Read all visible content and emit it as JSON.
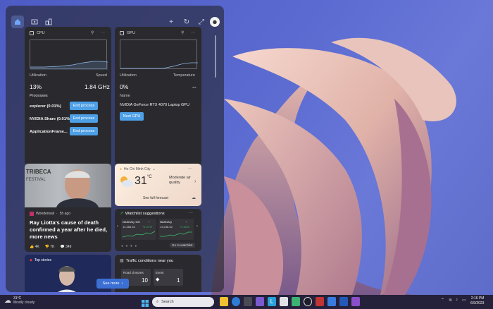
{
  "panel": {
    "icons": [
      "home-icon",
      "video-icon",
      "widgets-icon",
      "plus-icon",
      "refresh-icon",
      "expand-icon"
    ]
  },
  "cpu": {
    "title": "CPU",
    "util_label": "Utilization",
    "speed_label": "Speed",
    "util": "13%",
    "speed": "1.84 GHz",
    "processes_label": "Processes",
    "procs": [
      {
        "name": "explorer (0.01%)",
        "action": "End process"
      },
      {
        "name": "NVIDIA Share (0.01%)",
        "action": "End process"
      },
      {
        "name": "ApplicationFrame...",
        "action": "End process"
      }
    ]
  },
  "gpu": {
    "title": "GPU",
    "util_label": "Utilization",
    "temp_label": "Temperature",
    "util": "0%",
    "temp": "--",
    "name_label": "Name",
    "name": "NVIDIA GeForce RTX 4070 Laptop GPU",
    "next": "Next GPU"
  },
  "news1": {
    "source": "Wonderwall",
    "time": "5h ago",
    "sign": "TRIBECA",
    "sign2": "FESTIVAL",
    "headline": "Ray Liotta's cause of death confirmed a year after he died, more news",
    "likes": "4K",
    "dislikes": "7K",
    "comments": "349"
  },
  "weather": {
    "city": "Ho Chi Minh City",
    "temp": "31",
    "unit": "°C",
    "aqi": "Moderate air quality",
    "forecast": "See full forecast"
  },
  "watch": {
    "title": "Watchlist suggestions",
    "items": [
      {
        "name": "NASDAQ 100",
        "value": "14,484.54",
        "change": "+1.27%"
      },
      {
        "name": "NASDAQ",
        "value": "13,238.52",
        "change": "+1.02%"
      }
    ],
    "goto": "Go to watchlist"
  },
  "top": {
    "label": "Top stories"
  },
  "traffic": {
    "title": "Traffic conditions near you",
    "road_label": "Road closures",
    "road": "10",
    "event_label": "Event",
    "event": "1"
  },
  "seemore": "See more",
  "taskbar": {
    "temp": "31°C",
    "cond": "Mostly cloudy",
    "search": "Search",
    "time": "2:16 PM",
    "date": "6/9/2023"
  }
}
